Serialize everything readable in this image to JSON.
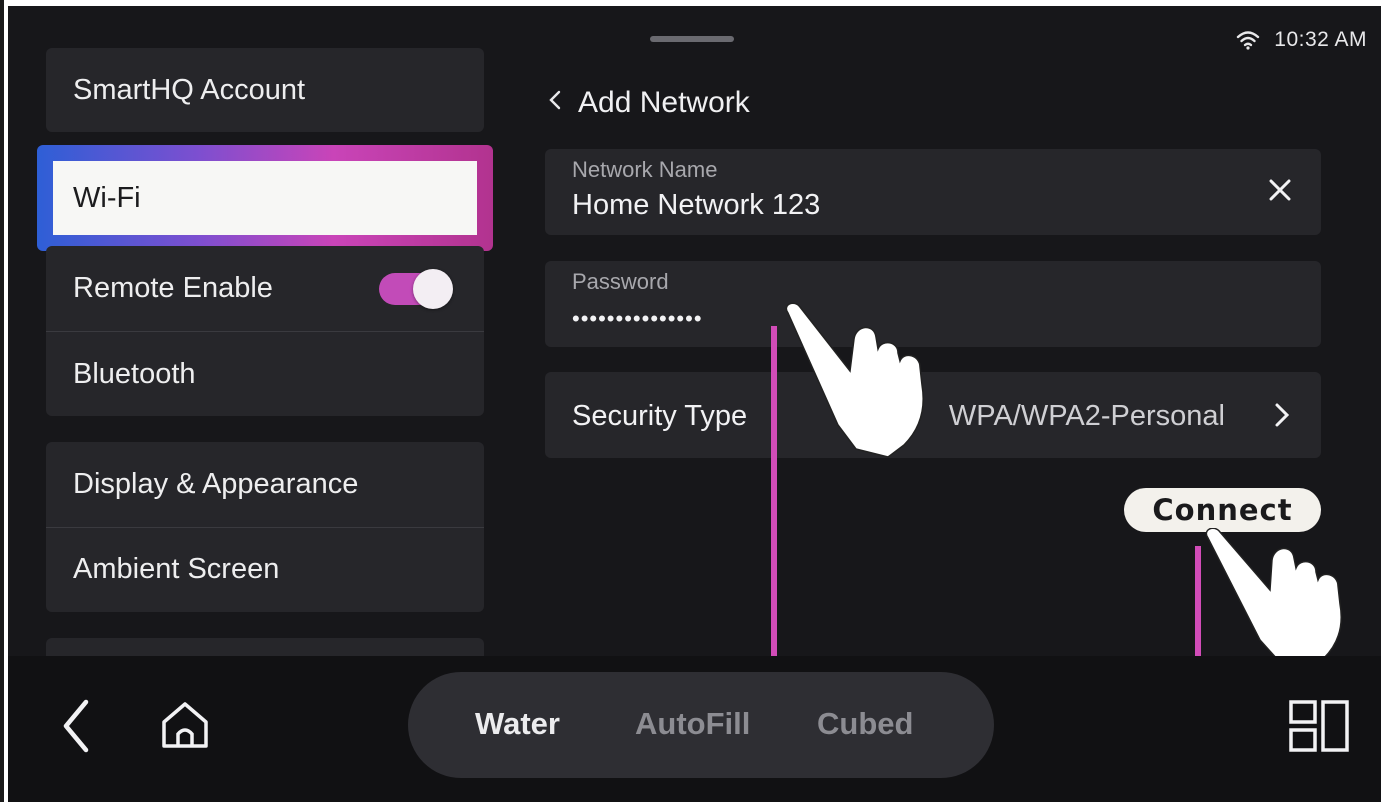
{
  "status": {
    "time": "10:32 AM",
    "wifi_icon": "wifi-icon"
  },
  "sidebar": {
    "account": "SmartHQ Account",
    "wifi": "Wi-Fi",
    "remote_enable": "Remote Enable",
    "remote_enable_on": true,
    "bluetooth": "Bluetooth",
    "display": "Display & Appearance",
    "ambient": "Ambient Screen"
  },
  "page": {
    "title": "Add Network"
  },
  "network_name": {
    "label": "Network Name",
    "value": "Home Network 123"
  },
  "password": {
    "label": "Password",
    "value": "•••••••••••••••"
  },
  "security": {
    "label": "Security Type",
    "value": "WPA/WPA2-Personal"
  },
  "connect": {
    "label": "Connect"
  },
  "bottom": {
    "tabs": [
      "Water",
      "AutoFill",
      "Cubed"
    ]
  },
  "colors": {
    "accent": "#c24bb8",
    "background": "#17171a",
    "card": "#26262a",
    "highlight_line": "#d24cb8"
  }
}
